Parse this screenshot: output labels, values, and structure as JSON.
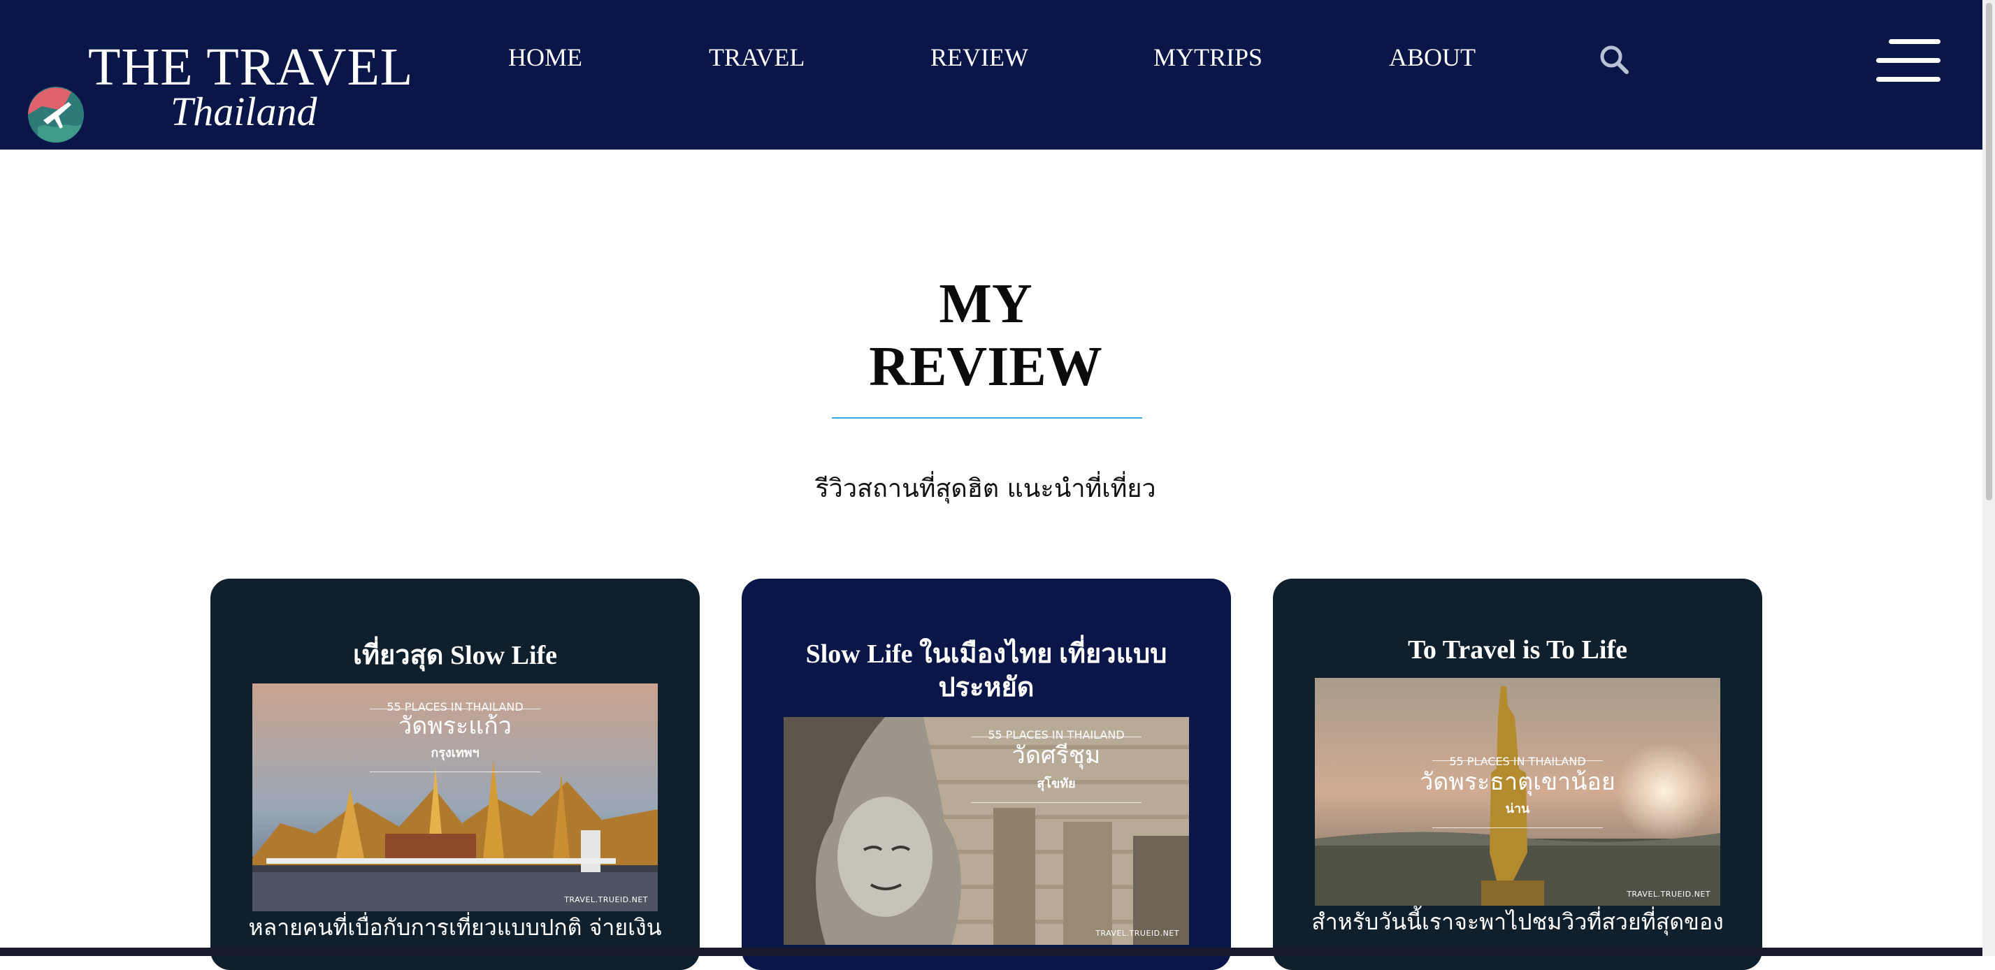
{
  "header": {
    "logo_title": "THE TRAVEL",
    "logo_subtitle": "Thailand",
    "nav": [
      "HOME",
      "TRAVEL",
      "REVIEW",
      "MYTRIPS",
      "ABOUT"
    ],
    "search_icon": "search-icon",
    "menu_icon": "hamburger-menu-icon",
    "background_color": "#0a1548"
  },
  "main": {
    "title_line1": "MY",
    "title_line2": "REVIEW",
    "subtitle": "รีวิวสถานที่สุดฮิต แนะนำที่เที่ยว",
    "accent_color": "#3aa9e6"
  },
  "cards": [
    {
      "title": "เที่ยวสุด Slow Life",
      "image_kicker": "55 PLACES IN THAILAND",
      "image_place": "วัดพระแก้ว",
      "image_province": "กรุงเทพฯ",
      "image_credit": "TRAVEL.TRUEID.NET",
      "excerpt": "หลายคนที่เบื่อกับการเที่ยวแบบปกติ จ่ายเงิน",
      "background": "#0f1f2c"
    },
    {
      "title": "Slow Life ในเมืองไทย เที่ยวแบบประหยัด",
      "image_kicker": "55 PLACES IN THAILAND",
      "image_place": "วัดศรีชุม",
      "image_province": "สุโขทัย",
      "image_credit": "TRAVEL.TRUEID.NET",
      "excerpt": "",
      "background": "#0a1548"
    },
    {
      "title": "To Travel is To Life",
      "image_kicker": "55 PLACES IN THAILAND",
      "image_place": "วัดพระธาตุเขาน้อย",
      "image_province": "น่าน",
      "image_credit": "TRAVEL.TRUEID.NET",
      "excerpt": "สำหรับวันนี้เราจะพาไปชมวิวที่สวยที่สุดของ",
      "background": "#0f1f2c"
    }
  ]
}
